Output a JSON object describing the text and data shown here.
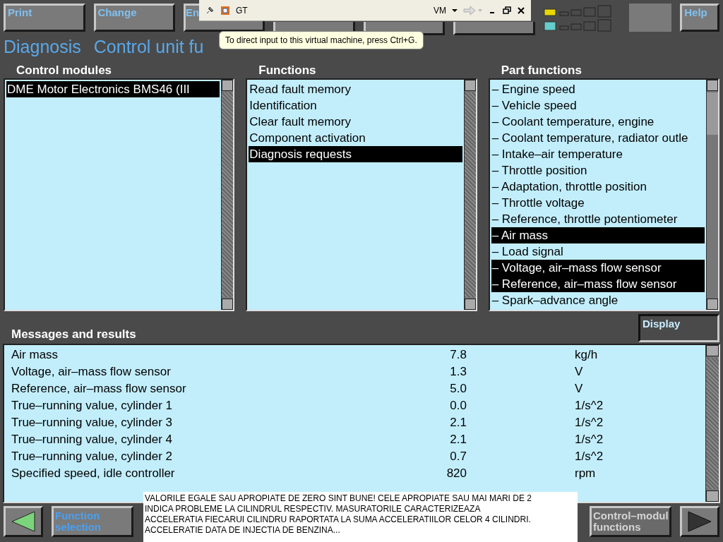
{
  "top_buttons": [
    {
      "kind": "text",
      "label": "Print"
    },
    {
      "kind": "text",
      "label": "Change"
    },
    {
      "kind": "text",
      "label": "En"
    },
    {
      "kind": "blank"
    },
    {
      "kind": "blank"
    },
    {
      "kind": "blank"
    },
    {
      "kind": "indicators"
    },
    {
      "kind": "blank"
    },
    {
      "kind": "text",
      "label": "Help"
    }
  ],
  "vm_toolbar": {
    "title": "GT",
    "menu": "VM"
  },
  "tooltip": "To direct input to this virtual machine, press Ctrl+G.",
  "heading": [
    "Diagnosis",
    "Control unit fu"
  ],
  "panels": [
    {
      "title": "Control modules",
      "items": [
        {
          "label": "DME Motor Electronics BMS46 (III",
          "selected": true
        }
      ]
    },
    {
      "title": "Functions",
      "items": [
        {
          "label": "Read fault memory",
          "selected": false
        },
        {
          "label": "Identification",
          "selected": false
        },
        {
          "label": "Clear fault memory",
          "selected": false
        },
        {
          "label": "Component activation",
          "selected": false
        },
        {
          "label": "Diagnosis requests",
          "selected": true
        }
      ]
    },
    {
      "title": "Part functions",
      "items": [
        {
          "label": "– Engine speed",
          "selected": false
        },
        {
          "label": "– Vehicle speed",
          "selected": false
        },
        {
          "label": "– Coolant temperature, engine",
          "selected": false
        },
        {
          "label": "– Coolant temperature, radiator outle",
          "selected": false
        },
        {
          "label": "– Intake–air temperature",
          "selected": false
        },
        {
          "label": "– Throttle position",
          "selected": false
        },
        {
          "label": "– Adaptation, throttle position",
          "selected": false
        },
        {
          "label": "– Throttle voltage",
          "selected": false
        },
        {
          "label": "– Reference, throttle potentiometer",
          "selected": false
        },
        {
          "label": "– Air mass",
          "selected": true
        },
        {
          "label": "– Load signal",
          "selected": false
        },
        {
          "label": "– Voltage, air–mass flow sensor",
          "selected": true
        },
        {
          "label": "– Reference, air–mass flow sensor",
          "selected": true
        },
        {
          "label": "– Spark–advance angle",
          "selected": false
        }
      ]
    }
  ],
  "display_button": "Display",
  "results": {
    "title": "Messages and results",
    "rows": [
      {
        "name": "Air mass",
        "value": "7.8",
        "unit": "kg/h"
      },
      {
        "name": "Voltage, air–mass flow sensor",
        "value": "1.3",
        "unit": "V"
      },
      {
        "name": "Reference, air–mass flow sensor",
        "value": "5.0",
        "unit": "V"
      },
      {
        "name": "True–running value, cylinder 1",
        "value": "0.0",
        "unit": "1/s^2"
      },
      {
        "name": "True–running value, cylinder 3",
        "value": "2.1",
        "unit": "1/s^2"
      },
      {
        "name": "True–running value, cylinder 4",
        "value": "2.1",
        "unit": "1/s^2"
      },
      {
        "name": "True–running value, cylinder 2",
        "value": "0.7",
        "unit": "1/s^2"
      },
      {
        "name": "Specified speed, idle controller",
        "value": "820",
        "unit": "rpm"
      }
    ]
  },
  "nav_buttons": [
    {
      "kind": "back"
    },
    {
      "kind": "text",
      "label": "Function\nselection",
      "disabled": false
    },
    {
      "kind": "gap"
    },
    {
      "kind": "text",
      "label": "Control–modul\nfunctions",
      "disabled": true
    },
    {
      "kind": "forward"
    }
  ],
  "note": "VALORILE EGALE SAU APROPIATE DE ZERO SINT BUNE! CELE APROPIATE SAU MAI MARI DE 2\nINDICA PROBLEME LA CILINDRUL RESPECTIV. MASURATORILE CARACTERIZEAZA\nACCELERATIA FIECARUI CILINDRU RAPORTATA LA SUMA ACCELERATIILOR CELOR 4 CILINDRI.\nACCELERATIE DATA DE INJECTIA DE BENZINA..."
}
